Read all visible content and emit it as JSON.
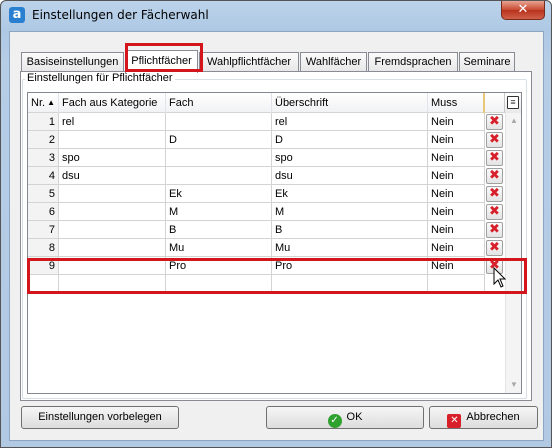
{
  "window": {
    "title": "Einstellungen der Fächerwahl",
    "app_icon": "a",
    "close_label": "✕"
  },
  "tabs": [
    {
      "label": "Basiseinstellungen"
    },
    {
      "label": "Pflichtfächer"
    },
    {
      "label": "Wahlpflichtfächer"
    },
    {
      "label": "Wahlfächer"
    },
    {
      "label": "Fremdsprachen"
    },
    {
      "label": "Seminare"
    }
  ],
  "active_tab": "Pflichtfächer",
  "group": {
    "label": "Einstellungen für Pflichtfächer"
  },
  "grid": {
    "columns": [
      "Nr.",
      "Fach aus Kategorie",
      "Fach",
      "Überschrift",
      "Muss"
    ],
    "sort_indicator": "▲",
    "delete_icon": "✖",
    "rows": [
      {
        "nr": "1",
        "kategorie": "rel",
        "fach": "",
        "ueberschrift": "rel",
        "muss": "Nein"
      },
      {
        "nr": "2",
        "kategorie": "",
        "fach": "D",
        "ueberschrift": "D",
        "muss": "Nein"
      },
      {
        "nr": "3",
        "kategorie": "spo",
        "fach": "",
        "ueberschrift": "spo",
        "muss": "Nein"
      },
      {
        "nr": "4",
        "kategorie": "dsu",
        "fach": "",
        "ueberschrift": "dsu",
        "muss": "Nein"
      },
      {
        "nr": "5",
        "kategorie": "",
        "fach": "Ek",
        "ueberschrift": "Ek",
        "muss": "Nein"
      },
      {
        "nr": "6",
        "kategorie": "",
        "fach": "M",
        "ueberschrift": "M",
        "muss": "Nein"
      },
      {
        "nr": "7",
        "kategorie": "",
        "fach": "B",
        "ueberschrift": "B",
        "muss": "Nein"
      },
      {
        "nr": "8",
        "kategorie": "",
        "fach": "Mu",
        "ueberschrift": "Mu",
        "muss": "Nein"
      },
      {
        "nr": "9",
        "kategorie": "",
        "fach": "Pro",
        "ueberschrift": "Pro",
        "muss": "Nein"
      },
      {
        "nr": "",
        "kategorie": "",
        "fach": "",
        "ueberschrift": "",
        "muss": ""
      }
    ]
  },
  "buttons": {
    "defaults": "Einstellungen vorbelegen",
    "ok": "OK",
    "cancel": "Abbrechen"
  },
  "colors": {
    "highlight": "#d2161b",
    "ok_icon": "#2fa12f",
    "cancel_icon": "#d8202a",
    "delete_icon": "#d8202a"
  }
}
